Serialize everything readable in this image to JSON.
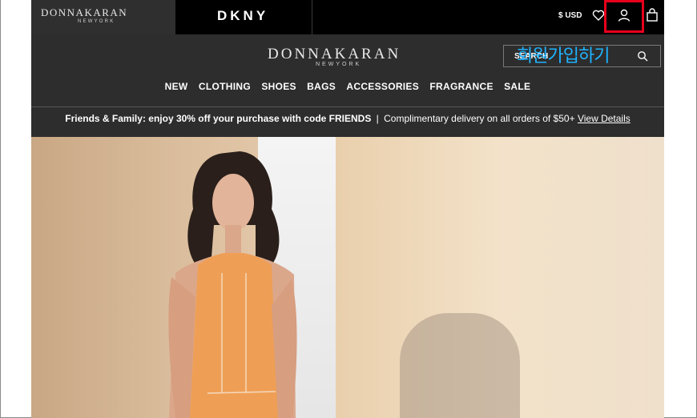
{
  "topbar": {
    "dk_wordmark": "DONNAKARAN",
    "dk_sub": "NEWYORK",
    "dkny": "DKNY",
    "currency": "$ USD"
  },
  "header": {
    "brand": "DONNAKARAN",
    "brand_sub": "NEWYORK",
    "search_label": "SEARCH",
    "annotation": "회원가입하기"
  },
  "nav": {
    "items": [
      "NEW",
      "CLOTHING",
      "SHOES",
      "BAGS",
      "ACCESSORIES",
      "FRAGRANCE",
      "SALE"
    ]
  },
  "promo": {
    "offer": "Friends & Family: enjoy 30% off your purchase with code FRIENDS",
    "separator": "|",
    "delivery": "Complimentary delivery on all orders of $50+",
    "link": "View Details"
  },
  "icons": {
    "heart": "heart-icon",
    "account": "user-icon",
    "bag": "shopping-bag-icon",
    "search": "search-icon"
  },
  "colors": {
    "highlight": "#e8001c",
    "annotation": "#1fb3ff",
    "header_bg": "#2d2d2d"
  }
}
